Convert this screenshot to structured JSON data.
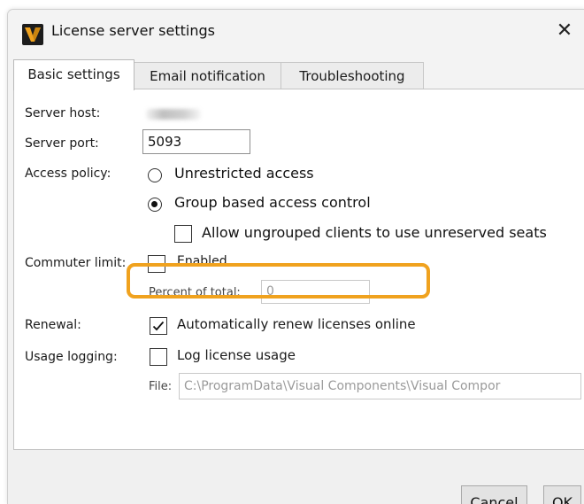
{
  "window": {
    "title": "License server settings",
    "close_glyph": "✕",
    "app_icon": "visual-components-logo",
    "accent_color": "#f0a21e"
  },
  "tabs": [
    {
      "label": "Basic settings",
      "active": true
    },
    {
      "label": "Email notification",
      "active": false
    },
    {
      "label": "Troubleshooting",
      "active": false
    }
  ],
  "form": {
    "server_host": {
      "label": "Server host:",
      "value_obscured": true
    },
    "server_port": {
      "label": "Server port:",
      "value": "5093"
    },
    "access_policy": {
      "label": "Access policy:",
      "options": [
        {
          "label": "Unrestricted access",
          "selected": false
        },
        {
          "label": "Group based access control",
          "selected": true
        }
      ],
      "allow_ungrouped": {
        "label": "Allow ungrouped clients to use unreserved seats",
        "checked": false
      }
    },
    "commuter_limit": {
      "label": "Commuter limit:",
      "enabled": {
        "label": "Enabled",
        "checked": false
      },
      "percent_label": "Percent of total:",
      "percent_value": "0"
    },
    "renewal": {
      "label": "Renewal:",
      "auto_renew": {
        "label": "Automatically renew licenses online",
        "checked": true
      }
    },
    "usage_logging": {
      "label": "Usage logging:",
      "log_usage": {
        "label": "Log license usage",
        "checked": false
      },
      "file_label": "File:",
      "file_value": "C:\\ProgramData\\Visual Components\\Visual Compor"
    }
  },
  "buttons": {
    "cancel": "Cancel",
    "ok": "OK"
  }
}
